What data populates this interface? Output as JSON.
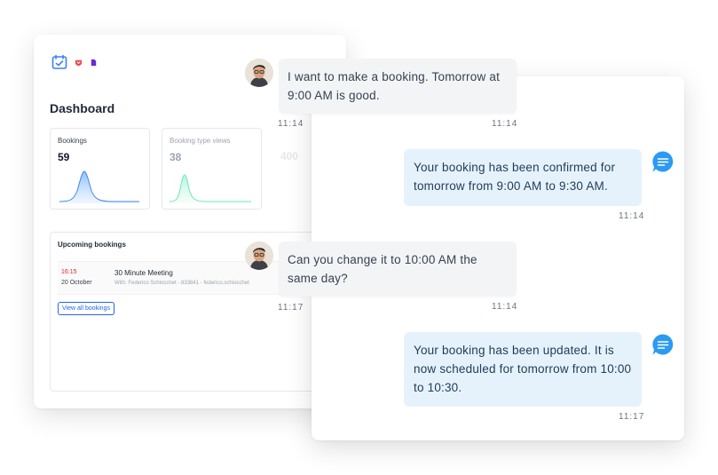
{
  "dashboard": {
    "title": "Dashboard",
    "stats": [
      {
        "label": "Bookings",
        "value": "59"
      },
      {
        "label": "Booking type views",
        "value": "38"
      },
      {
        "label": "",
        "value": "400"
      }
    ],
    "upcoming": {
      "title": "Upcoming bookings",
      "row": {
        "time": "16:15",
        "date": "20 October",
        "meeting": "30 Minute Meeting",
        "with": "With: Federico Schiocchet - 833841 - federico.schiocchet"
      },
      "view_all": "View all bookings"
    }
  },
  "chat": {
    "messages": [
      {
        "role": "user",
        "text": "I want to make a booking. Tomorrow at 9:00 AM is good.",
        "time": "11:14"
      },
      {
        "role": "bot",
        "text": "Your booking has been confirmed for tomorrow from 9:00 AM to 9:30 AM.",
        "time": "11:14"
      },
      {
        "role": "user",
        "text": "Can you change it to 10:00 AM the same day?",
        "time": "11:14"
      },
      {
        "role": "bot",
        "text": "Your booking has been updated. It is now scheduled for tomorrow from 10:00 to 10:30.",
        "time": "11:17"
      }
    ],
    "behind_times": [
      "11:14",
      "11:17"
    ]
  },
  "colors": {
    "accent": "#3b82f6",
    "bot_bubble": "#e6f2fb",
    "user_bubble": "#f3f4f6",
    "bot_icon": "#2b9af3"
  },
  "icons": {
    "app_logo": "calendar-check-icon",
    "bot": "chat-bubble-icon",
    "avatar": "user-avatar"
  }
}
